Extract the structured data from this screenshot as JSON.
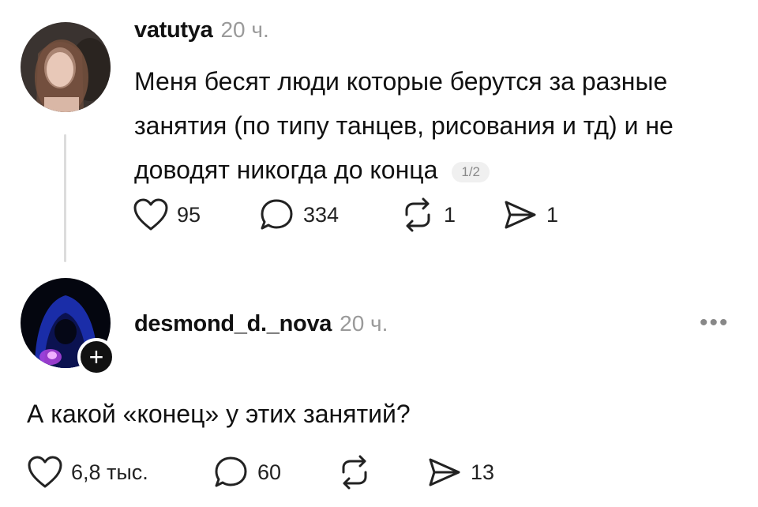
{
  "post": {
    "username": "vatutya",
    "time": "20 ч.",
    "text_lines": [
      "Меня бесят люди которые берутся за разные",
      "занятия (по типу танцев, рисования и тд) и не",
      "доводят никогда до конца"
    ],
    "counter": "1/2",
    "actions": {
      "likes": "95",
      "comments": "334",
      "reposts": "1",
      "shares": "1"
    }
  },
  "reply": {
    "username": "desmond_d._nova",
    "time": "20 ч.",
    "text": "А какой «конец» у этих занятий?",
    "actions": {
      "likes": "6,8 тыс.",
      "comments": "60",
      "shares": "13"
    }
  },
  "icons": {
    "like": "heart-icon",
    "comment": "comment-bubble-icon",
    "repost": "repost-icon",
    "share": "send-icon",
    "more": "more-dots-icon",
    "follow": "plus-icon"
  }
}
